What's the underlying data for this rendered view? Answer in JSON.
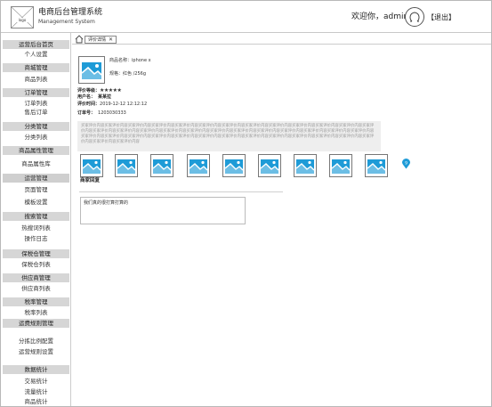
{
  "header": {
    "logo_text": "logo",
    "title": "电商后台管理系统",
    "subtitle": "Management System",
    "welcome": "欢迎你，admin",
    "logout": "【退出】"
  },
  "sidebar": {
    "items": [
      {
        "label": "运营后台首页",
        "type": "head"
      },
      {
        "label": "个人设置",
        "type": "plain"
      },
      {
        "label": "商城管理",
        "type": "head"
      },
      {
        "label": "商品列表",
        "type": "plain"
      },
      {
        "label": "订单管理",
        "type": "head"
      },
      {
        "label": "订单列表",
        "type": "plain"
      },
      {
        "label": "售后订单",
        "type": "plain"
      },
      {
        "label": "分类管理",
        "type": "head"
      },
      {
        "label": "分类列表",
        "type": "plain"
      },
      {
        "label": "商品属性管理",
        "type": "head"
      },
      {
        "label": "商品属性库",
        "type": "plain"
      },
      {
        "label": "运营管理",
        "type": "sel"
      },
      {
        "label": "页面管理",
        "type": "plain"
      },
      {
        "label": "模板设置",
        "type": "plain"
      },
      {
        "label": "搜索管理",
        "type": "head"
      },
      {
        "label": "热搜词列表",
        "type": "plain"
      },
      {
        "label": "操作日志",
        "type": "plain"
      },
      {
        "label": "保税仓管理",
        "type": "head"
      },
      {
        "label": "保税仓列表",
        "type": "plain"
      },
      {
        "label": "供应商管理",
        "type": "head"
      },
      {
        "label": "供应商列表",
        "type": "plain"
      },
      {
        "label": "税率管理",
        "type": "head"
      },
      {
        "label": "税率列表",
        "type": "plain"
      },
      {
        "label": "运费规则管理",
        "type": "head"
      },
      {
        "label": "分拣比例配置",
        "type": "plain"
      },
      {
        "label": "运营规则设置",
        "type": "plain"
      },
      {
        "label": "数据统计",
        "type": "head"
      },
      {
        "label": "交易统计",
        "type": "plain"
      },
      {
        "label": "流量统计",
        "type": "plain"
      },
      {
        "label": "商品统计",
        "type": "plain"
      }
    ]
  },
  "tabs": {
    "active_label": "评价详情",
    "close_glyph": "✕"
  },
  "product": {
    "name_label": "商品名称：",
    "name_value": "iphone x",
    "spec_label": "规格：",
    "spec_value": "红色 /256g"
  },
  "review": {
    "rating_label": "评价等级：",
    "rating_stars": "★★★★★",
    "rating_value": 5,
    "user_label": "用户名：",
    "user_value": "某某拉",
    "time_label": "评价时间：",
    "time_value": "2019-12-12  12:12:12",
    "order_label": "订单号：",
    "order_value": "1203030333",
    "comment_text": "买家评价内容买家评价内容买家评价内容买家评价内容买家评价内容买家评价内容买家评价内容买家评价内容买家评价内容买家评价内容买家评价内容买家评价内容买家评价内容买家评价内容买家评价内容买家评价内容买家评价内容买家评价内容买家评价内容买家评价内容买家评价内容买家评价内容买家评价内容买家评价内容买家评价内容买家评价内容买家评价内容买家评价内容买家评价内容买家评价内容买家评价内容买家评价内容买家评价内容买家评价内容买家评价内容买家评价内容买家评价内容买家评价内容买家评价内容买家评价内容",
    "image_count": 9,
    "badge_count": "9"
  },
  "reply": {
    "title": "商家回复",
    "text": "我们真的很打算打算的"
  },
  "colors": {
    "image_blue": "#1e9bd7",
    "sidebar_head": "#d6d6d6",
    "comment_bg": "#eeeeee"
  }
}
